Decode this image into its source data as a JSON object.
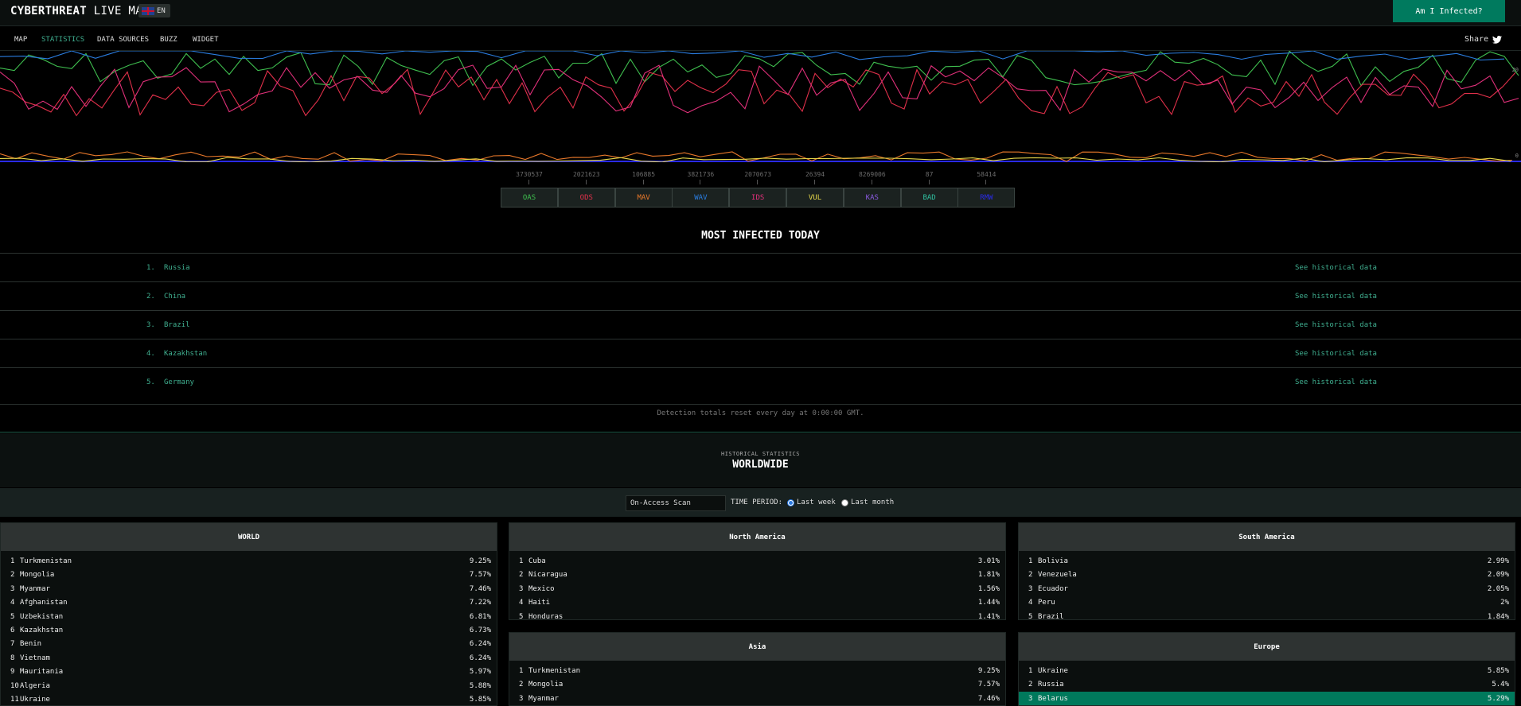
{
  "header": {
    "brand_bold": "CYBERTHREAT",
    "brand_light": "LIVE MAP",
    "lang": "EN",
    "infected_button": "Am I Infected?"
  },
  "nav": {
    "items": [
      "MAP",
      "STATISTICS",
      "DATA SOURCES",
      "BUZZ",
      "WIDGET"
    ],
    "active": "STATISTICS",
    "share": "Share"
  },
  "chart": {
    "axis_top": "20",
    "axis_bottom": "0"
  },
  "legend": [
    {
      "count": "3730537",
      "label": "OAS",
      "color": "#3fbf4f"
    },
    {
      "count": "2021623",
      "label": "ODS",
      "color": "#e0304a"
    },
    {
      "count": "106885",
      "label": "MAV",
      "color": "#e8782a"
    },
    {
      "count": "3821736",
      "label": "WAV",
      "color": "#2a7de0"
    },
    {
      "count": "2070673",
      "label": "IDS",
      "color": "#e0307a"
    },
    {
      "count": "26394",
      "label": "VUL",
      "color": "#e8d84a"
    },
    {
      "count": "8269006",
      "label": "KAS",
      "color": "#8a5ae0"
    },
    {
      "count": "87",
      "label": "BAD",
      "color": "#30c0a0"
    },
    {
      "count": "58414",
      "label": "RMW",
      "color": "#2a2ae8"
    }
  ],
  "most_infected": {
    "title": "MOST INFECTED TODAY",
    "rows": [
      {
        "rank": "1.",
        "country": "Russia",
        "link": "See historical data"
      },
      {
        "rank": "2.",
        "country": "China",
        "link": "See historical data"
      },
      {
        "rank": "3.",
        "country": "Brazil",
        "link": "See historical data"
      },
      {
        "rank": "4.",
        "country": "Kazakhstan",
        "link": "See historical data"
      },
      {
        "rank": "5.",
        "country": "Germany",
        "link": "See historical data"
      }
    ],
    "note": "Detection totals reset every day at 0:00:00 GMT."
  },
  "historical": {
    "subtitle": "HISTORICAL STATISTICS",
    "title": "WORLDWIDE",
    "scan_select": "On-Access Scan",
    "time_period_label": "TIME PERIOD:",
    "options": [
      "Last week",
      "Last month"
    ],
    "selected": "Last week"
  },
  "regions": {
    "world": {
      "title": "WORLD",
      "rows": [
        {
          "rank": "1",
          "name": "Turkmenistan",
          "value": "9.25%"
        },
        {
          "rank": "2",
          "name": "Mongolia",
          "value": "7.57%"
        },
        {
          "rank": "3",
          "name": "Myanmar",
          "value": "7.46%"
        },
        {
          "rank": "4",
          "name": "Afghanistan",
          "value": "7.22%"
        },
        {
          "rank": "5",
          "name": "Uzbekistan",
          "value": "6.81%"
        },
        {
          "rank": "6",
          "name": "Kazakhstan",
          "value": "6.73%"
        },
        {
          "rank": "7",
          "name": "Benin",
          "value": "6.24%"
        },
        {
          "rank": "8",
          "name": "Vietnam",
          "value": "6.24%"
        },
        {
          "rank": "9",
          "name": "Mauritania",
          "value": "5.97%"
        },
        {
          "rank": "10",
          "name": "Algeria",
          "value": "5.88%"
        },
        {
          "rank": "11",
          "name": "Ukraine",
          "value": "5.85%"
        }
      ]
    },
    "north_america": {
      "title": "North America",
      "rows": [
        {
          "rank": "1",
          "name": "Cuba",
          "value": "3.01%"
        },
        {
          "rank": "2",
          "name": "Nicaragua",
          "value": "1.81%"
        },
        {
          "rank": "3",
          "name": "Mexico",
          "value": "1.56%"
        },
        {
          "rank": "4",
          "name": "Haiti",
          "value": "1.44%"
        },
        {
          "rank": "5",
          "name": "Honduras",
          "value": "1.41%"
        }
      ]
    },
    "south_america": {
      "title": "South America",
      "rows": [
        {
          "rank": "1",
          "name": "Bolivia",
          "value": "2.99%"
        },
        {
          "rank": "2",
          "name": "Venezuela",
          "value": "2.09%"
        },
        {
          "rank": "3",
          "name": "Ecuador",
          "value": "2.05%"
        },
        {
          "rank": "4",
          "name": "Peru",
          "value": "2%"
        },
        {
          "rank": "5",
          "name": "Brazil",
          "value": "1.84%"
        }
      ]
    },
    "asia": {
      "title": "Asia",
      "rows": [
        {
          "rank": "1",
          "name": "Turkmenistan",
          "value": "9.25%"
        },
        {
          "rank": "2",
          "name": "Mongolia",
          "value": "7.57%"
        },
        {
          "rank": "3",
          "name": "Myanmar",
          "value": "7.46%"
        }
      ]
    },
    "europe": {
      "title": "Europe",
      "rows": [
        {
          "rank": "1",
          "name": "Ukraine",
          "value": "5.85%"
        },
        {
          "rank": "2",
          "name": "Russia",
          "value": "5.4%"
        },
        {
          "rank": "3",
          "name": "Belarus",
          "value": "5.29%"
        }
      ]
    }
  }
}
